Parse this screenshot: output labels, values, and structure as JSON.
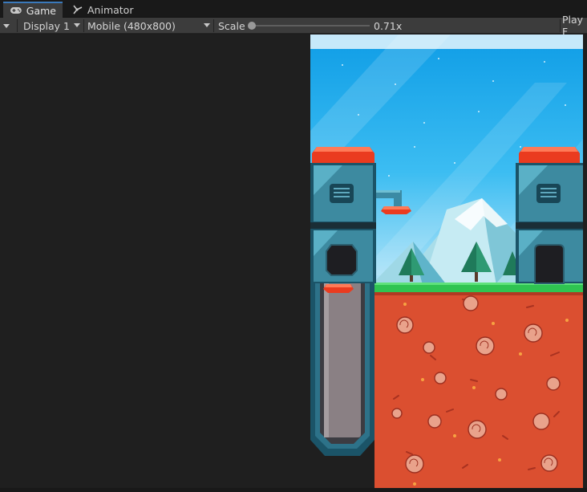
{
  "tabs": [
    {
      "label": "Game",
      "icon": "gamepad-icon",
      "active": true
    },
    {
      "label": "Animator",
      "icon": "animator-icon",
      "active": false
    }
  ],
  "toolbar": {
    "display": "Display 1",
    "resolution": "Mobile (480x800)",
    "scale_label": "Scale",
    "scale_value": "0.71x",
    "scale_fraction": 0.0,
    "play_label": "Play F"
  },
  "colors": {
    "editor_bg": "#1e1e1e",
    "toolbar_bg": "#3c3c3c",
    "tab_accent": "#3a79bb",
    "sky_top": "#16a6ea",
    "sky_bottom": "#a8e0f8",
    "grass": "#2fc451",
    "soil": "#db4f30",
    "tower_teal": "#3d8aa0",
    "roof_red": "#ea3b1f"
  }
}
